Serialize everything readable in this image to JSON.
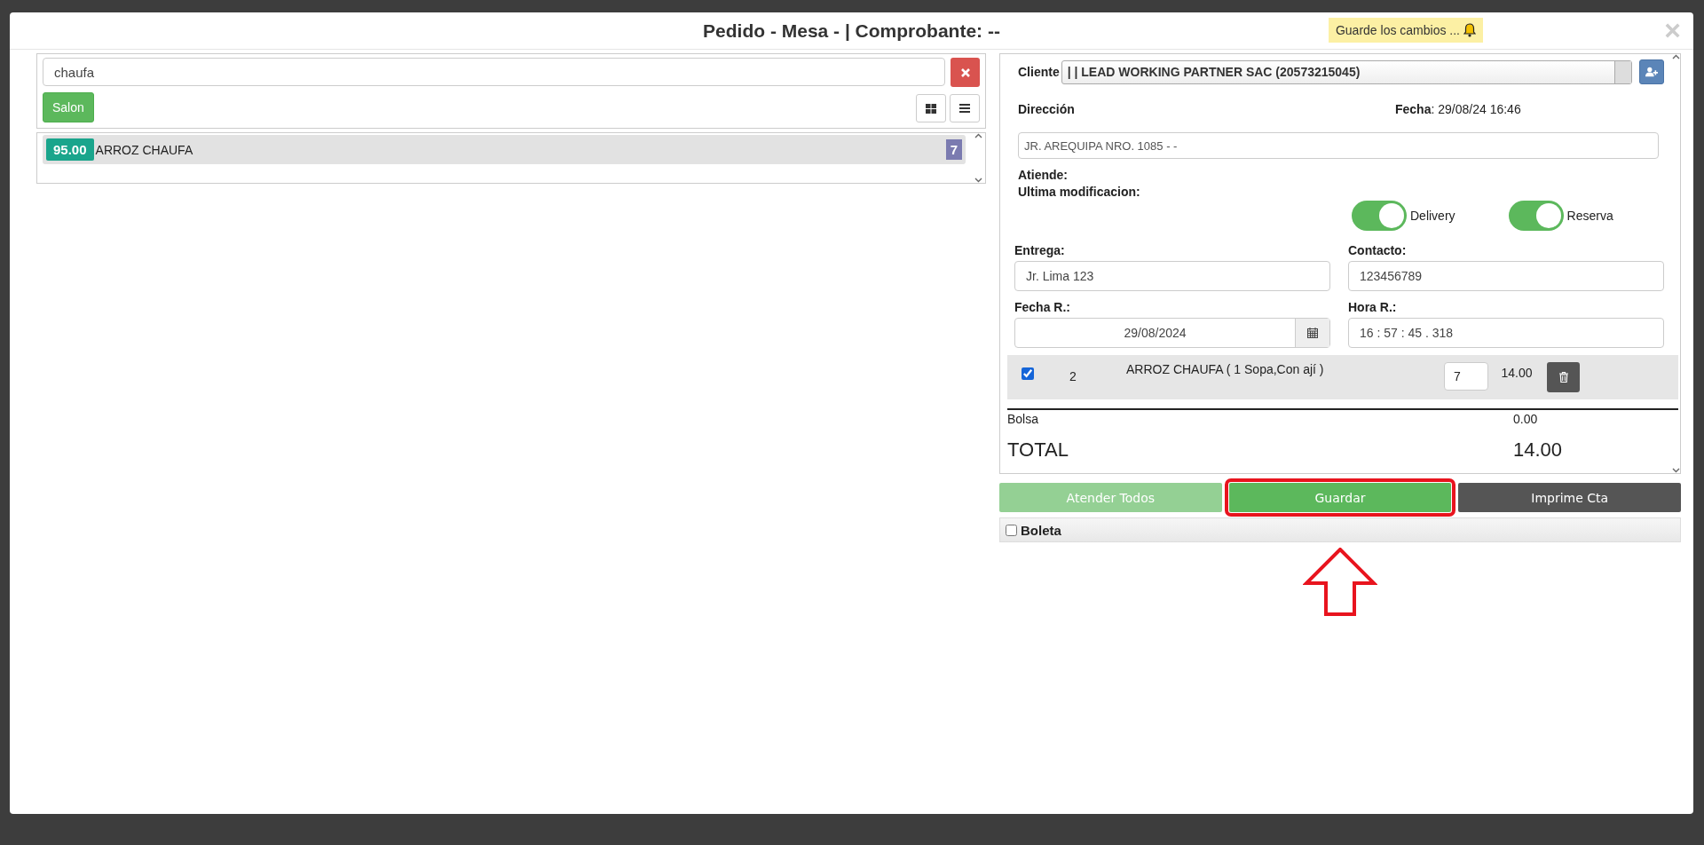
{
  "dialog": {
    "title": "Pedido - Mesa - | Comprobante: --",
    "notice": "Guarde los cambios ...",
    "close": "×"
  },
  "search": {
    "value": "chaufa"
  },
  "filter_buttons": [
    {
      "label": "Salon",
      "selected": true
    }
  ],
  "products": [
    {
      "price": "95.00",
      "name": "ARROZ CHAUFA",
      "count": "7"
    }
  ],
  "order": {
    "cliente_label": "Cliente",
    "cliente": "| | LEAD WORKING PARTNER SAC (20573215045)",
    "direccion_label": "Dirección",
    "fecha": "**Fecha**: 29/08/24 16:46",
    "direccion": "JR. AREQUIPA NRO. 1085 - -",
    "atiende_label": "Atiende:",
    "ultima_label": "Ultima modificacion:"
  },
  "toggles": [
    {
      "label": "Delivery",
      "on": true
    },
    {
      "label": "Reserva",
      "on": true
    }
  ],
  "fields": [
    {
      "label": "Entrega:",
      "value": "Jr. Lima 123",
      "kind": "text"
    },
    {
      "label": "Contacto:",
      "value": "123456789",
      "kind": "text"
    },
    {
      "label": "Fecha R.:",
      "value": "29/08/2024",
      "kind": "date"
    },
    {
      "label": "Hora R.:",
      "value": "16 : 57 : 45 . 318",
      "kind": "time"
    }
  ],
  "items": [
    {
      "checked": true,
      "number": "2",
      "name": "ARROZ CHAUFA ( 1 Sopa,Con ají )",
      "quantity": "7",
      "amount": "14.00"
    }
  ],
  "bolsa": {
    "label": "Bolsa",
    "value": "0.00"
  },
  "total": {
    "label": "TOTAL",
    "value": "14.00"
  },
  "actions": [
    {
      "label": "Atender Todos",
      "kind": "success",
      "disabled": true,
      "highlighted": false
    },
    {
      "label": "Guardar",
      "kind": "success",
      "disabled": false,
      "highlighted": true
    },
    {
      "label": "Imprime Cta",
      "kind": "dark",
      "disabled": false,
      "highlighted": false
    }
  ],
  "boleta": {
    "label": "Boleta",
    "checked": false
  }
}
